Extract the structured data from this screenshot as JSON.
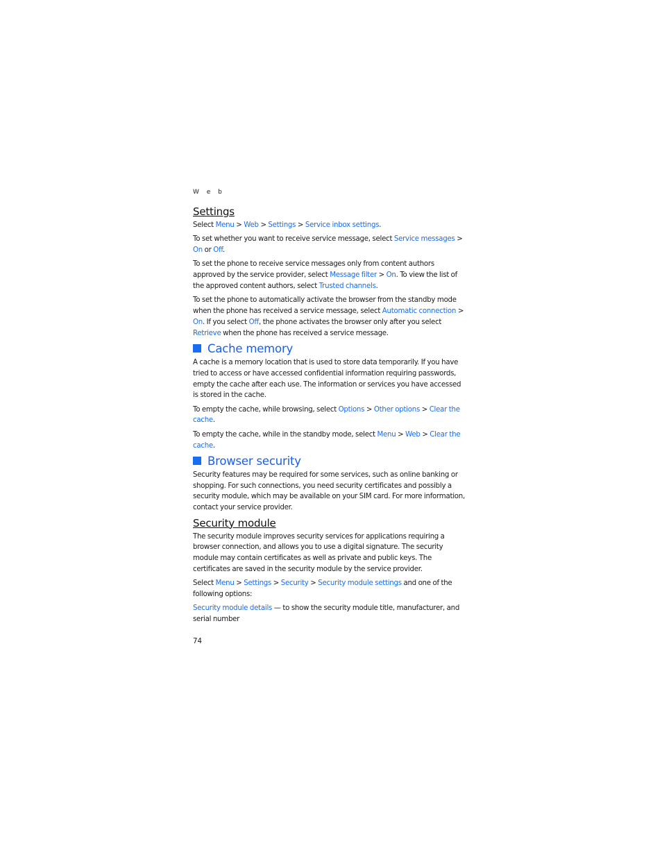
{
  "running_head": "W e b",
  "page_number": "74",
  "colors": {
    "link": "#1a6cf0",
    "heading": "#1a5fe6"
  },
  "settings": {
    "heading": "Settings",
    "p1": {
      "t0": "Select ",
      "l1": "Menu",
      "t1": " > ",
      "l2": "Web",
      "t2": " > ",
      "l3": "Settings",
      "t3": " > ",
      "l4": "Service inbox settings",
      "t4": "."
    },
    "p2": {
      "t0": "To set whether you want to receive service message, select ",
      "l1": "Service messages",
      "t1": " > ",
      "l2": "On",
      "t2": " or ",
      "l3": "Off",
      "t3": "."
    },
    "p3": {
      "t0": "To set the phone to receive service messages only from content authors approved by the service provider, select ",
      "l1": "Message filter",
      "t1": " > ",
      "l2": "On",
      "t2": ". To view the list of the approved content authors, select ",
      "l3": "Trusted channels",
      "t3": "."
    },
    "p4": {
      "t0": "To set the phone to automatically activate the browser from the standby mode when the phone has received a service message, select ",
      "l1": "Automatic connection",
      "t1": " > ",
      "l2": "On",
      "t2": ". If you select ",
      "l3": "Off",
      "t3": ", the phone activates the browser only after you select ",
      "l4": "Retrieve",
      "t4": " when the phone has received a service message."
    }
  },
  "cache": {
    "heading": "Cache memory",
    "p1": "A cache is a memory location that is used to store data temporarily. If you have tried to access or have accessed confidential information requiring passwords, empty the cache after each use. The information or services you have accessed is stored in the cache.",
    "p2": {
      "t0": "To empty the cache, while browsing, select ",
      "l1": "Options",
      "t1": " > ",
      "l2": "Other options",
      "t2": " > ",
      "l3": "Clear the cache",
      "t3": "."
    },
    "p3": {
      "t0": "To empty the cache, while in the standby mode, select ",
      "l1": "Menu",
      "t1": " > ",
      "l2": "Web",
      "t2": " > ",
      "l3": "Clear the cache",
      "t3": "."
    }
  },
  "browser_security": {
    "heading": "Browser security",
    "p1": "Security features may be required for some services, such as online banking or shopping. For such connections, you need security certificates and possibly a security module, which may be available on your SIM card. For more information, contact your service provider."
  },
  "security_module": {
    "heading": "Security module",
    "p1": "The security module improves security services for applications requiring a browser connection, and allows you to use a digital signature. The security module may contain certificates as well as private and public keys. The certificates are saved in the security module by the service provider.",
    "p2": {
      "t0": "Select ",
      "l1": "Menu",
      "t1": " > ",
      "l2": "Settings",
      "t2": " > ",
      "l3": "Security",
      "t3": " > ",
      "l4": "Security module settings",
      "t4": " and one of the following options:"
    },
    "p3": {
      "l1": "Security module details",
      "t1": " — to show the security module title, manufacturer, and serial number"
    }
  }
}
